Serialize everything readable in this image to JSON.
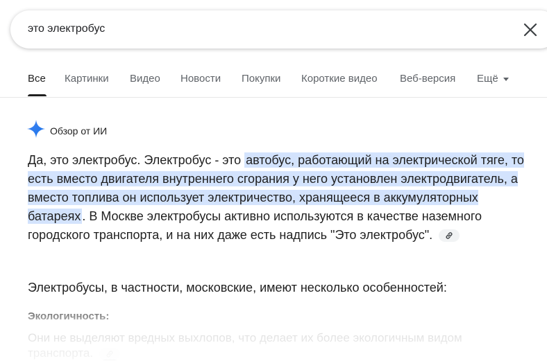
{
  "search": {
    "query": "это электробус"
  },
  "tabs": [
    {
      "label": "Все"
    },
    {
      "label": "Картинки"
    },
    {
      "label": "Видео"
    },
    {
      "label": "Новости"
    },
    {
      "label": "Покупки"
    },
    {
      "label": "Короткие видео"
    },
    {
      "label": "Веб-версия"
    },
    {
      "label": "Ещё"
    }
  ],
  "ai_overview": {
    "title": "Обзор от ИИ",
    "answer_intro": "Да, это электробус. Электробус - это ",
    "answer_highlight": "автобус, работающий на электрической тяге, то есть вместо двигателя внутреннего сгорания у него установлен электродвигатель, а вместо топлива он использует электричество, хранящееся в аккумуляторных батареях",
    "answer_rest": ". В Москве электробусы активно используются в качестве наземного городского транспорта, и на них даже есть надпись \"Это электробус\".",
    "sub_intro": "Электробусы, в частности, московские, имеют несколько особенностей:",
    "section_heading": "Экологичность:",
    "section_text": "Они не выделяют вредных выхлопов, что делает их более экологичным видом транспорта."
  },
  "colors": {
    "highlight": "#d3e3fd",
    "gemini_start": "#4285f4",
    "gemini_end": "#1a73e8"
  },
  "icons": {
    "clear": "close-icon",
    "ai": "sparkle-icon",
    "link": "link-icon"
  }
}
